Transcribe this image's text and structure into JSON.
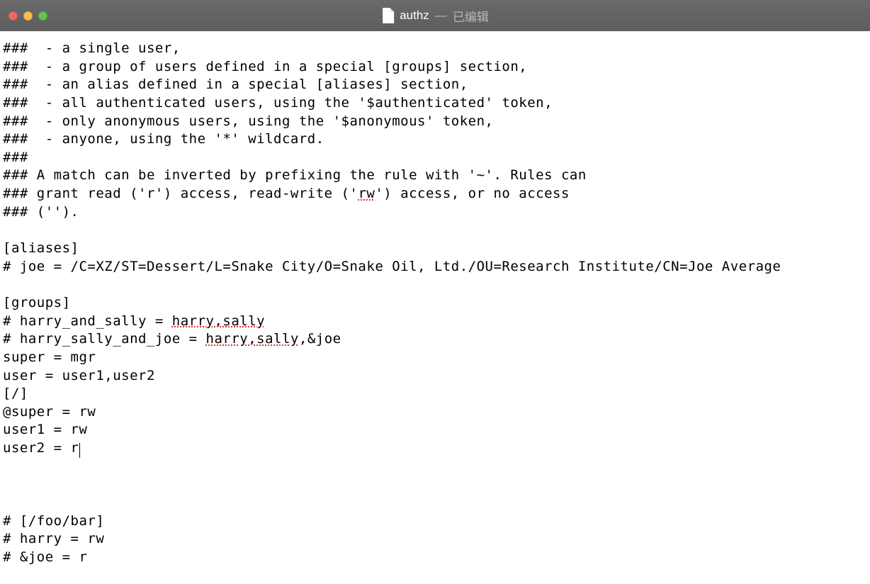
{
  "titlebar": {
    "filename": "authz",
    "separator": "—",
    "status": "已编辑"
  },
  "editor": {
    "lines": [
      "###  - a single user,",
      "###  - a group of users defined in a special [groups] section,",
      "###  - an alias defined in a special [aliases] section,",
      "###  - all authenticated users, using the '$authenticated' token,",
      "###  - only anonymous users, using the '$anonymous' token,",
      "###  - anyone, using the '*' wildcard.",
      "###",
      "### A match can be inverted by prefixing the rule with '~'. Rules can",
      "### grant read ('r') access, read-write ('rw') access, or no access",
      "### ('').",
      "",
      "[aliases]",
      "# joe = /C=XZ/ST=Dessert/L=Snake City/O=Snake Oil, Ltd./OU=Research Institute/CN=Joe Average",
      "",
      "[groups]",
      "# harry_and_sally = harry,sally",
      "# harry_sally_and_joe = harry,sally,&joe",
      "super = mgr",
      "user = user1,user2",
      "[/]",
      "@super = rw",
      "user1 = rw",
      "user2 = r",
      "",
      "",
      "",
      "# [/foo/bar]",
      "# harry = rw",
      "# &joe = r"
    ],
    "spell_errors": {
      "rw_line8": "rw",
      "harry_sally_15": "harry,sally",
      "harry_sally_16": "harry,sally"
    },
    "cursor_line": 22
  }
}
